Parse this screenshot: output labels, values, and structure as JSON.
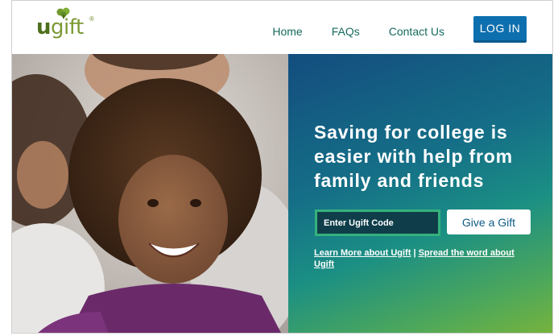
{
  "brand": {
    "logo_main": "u",
    "logo_rest": "gift",
    "logo_reg": "®"
  },
  "nav": {
    "home": "Home",
    "faqs": "FAQs",
    "contact": "Contact Us",
    "login": "LOG IN"
  },
  "hero": {
    "headline": "Saving for college is easier with help from family and friends",
    "code_placeholder": "Enter Ugift Code",
    "give_button": "Give a Gift",
    "learn_link": "Learn More about Ugift",
    "separator": "|",
    "spread_link": "Spread the word about Ugift"
  },
  "colors": {
    "nav_link": "#166a5e",
    "login_button": "#0d6fae",
    "panel_gradient_top": "#134d7f",
    "panel_gradient_bottom": "#77b33c",
    "input_border": "#35b27c"
  },
  "icons": {
    "logo_leaf": "leaf-icon"
  }
}
